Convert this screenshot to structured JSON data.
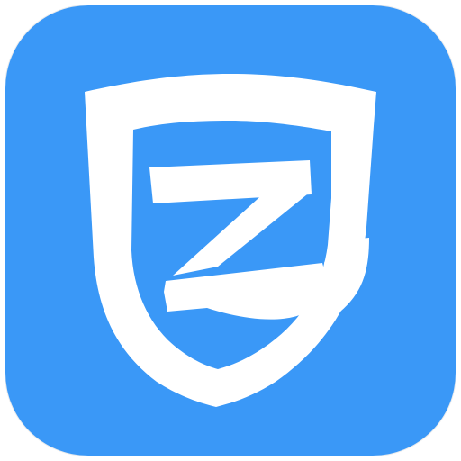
{
  "app_icon": {
    "name": "shield-z-logo",
    "icon": "shield-z-icon",
    "colors": {
      "background": "#3a98f7",
      "foreground": "#ffffff"
    }
  }
}
